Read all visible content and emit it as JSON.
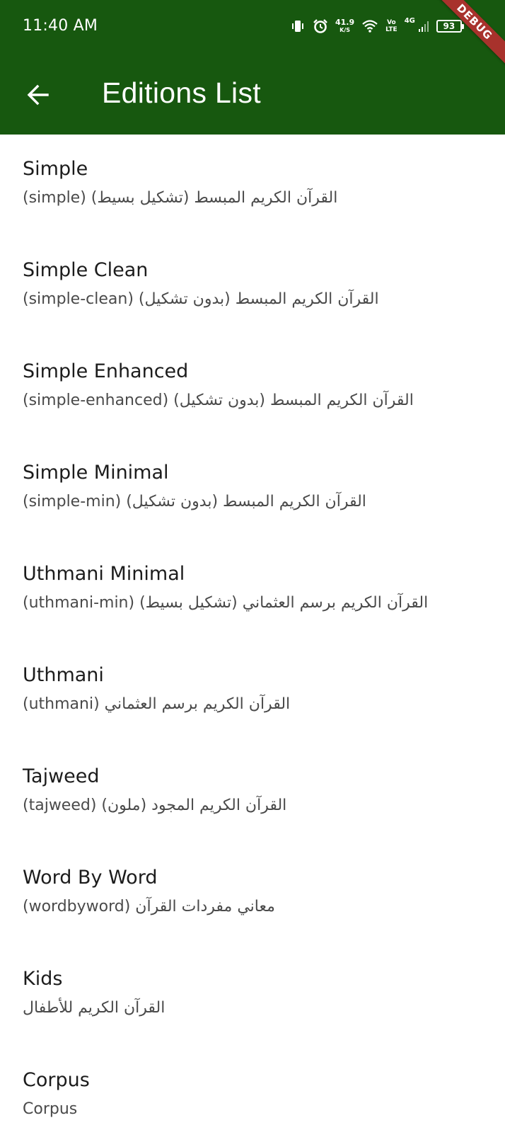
{
  "status_bar": {
    "time": "11:40 AM",
    "speed_value": "41.9",
    "speed_unit": "K/S",
    "volte_top": "Vo",
    "volte_bottom": "LTE",
    "network": "4G",
    "battery": "93"
  },
  "debug_banner": "DEBUG",
  "app_bar": {
    "title": "Editions List"
  },
  "editions": [
    {
      "title": "Simple",
      "subtitle": "القرآن الكريم المبسط (تشكيل بسيط) (simple)"
    },
    {
      "title": "Simple Clean",
      "subtitle": "القرآن الكريم المبسط (بدون تشكيل) (simple-clean)"
    },
    {
      "title": "Simple Enhanced",
      "subtitle": "القرآن الكريم المبسط (بدون تشكيل) (simple-enhanced)"
    },
    {
      "title": "Simple Minimal",
      "subtitle": "القرآن الكريم المبسط (بدون تشكيل) (simple-min)"
    },
    {
      "title": "Uthmani Minimal",
      "subtitle": "القرآن الكريم برسم العثماني (تشكيل بسيط) (uthmani-min)"
    },
    {
      "title": "Uthmani",
      "subtitle": "القرآن الكريم برسم العثماني (uthmani)"
    },
    {
      "title": "Tajweed",
      "subtitle": "القرآن الكريم المجود (ملون) (tajweed)"
    },
    {
      "title": "Word By Word",
      "subtitle": "معاني مفردات القرآن (wordbyword)"
    },
    {
      "title": "Kids",
      "subtitle": "القرآن الكريم للأطفال"
    },
    {
      "title": "Corpus",
      "subtitle": "Corpus"
    }
  ]
}
